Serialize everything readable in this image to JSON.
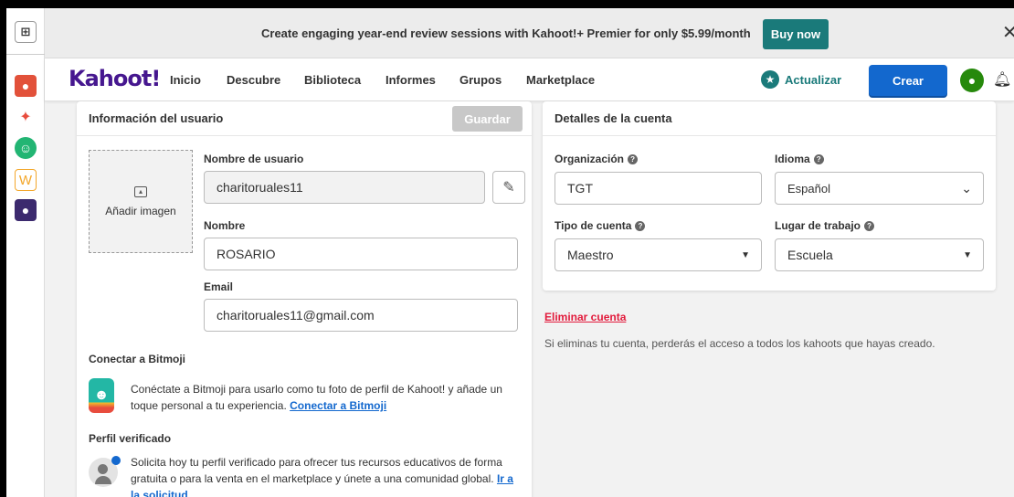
{
  "banner": {
    "text": "Create engaging year-end review sessions with Kahoot!+ Premier for only $5.99/month",
    "button": "Buy now",
    "close": "✕"
  },
  "nav": {
    "logo": "Kahoot!",
    "items": [
      "Inicio",
      "Descubre",
      "Biblioteca",
      "Informes",
      "Grupos",
      "Marketplace"
    ],
    "upgrade": "Actualizar",
    "create": "Crear"
  },
  "user_info": {
    "title": "Información del usuario",
    "save": "Guardar",
    "add_image": "Añadir imagen",
    "username_label": "Nombre de usuario",
    "username": "charitoruales11",
    "name_label": "Nombre",
    "name": "ROSARIO",
    "email_label": "Email",
    "email": "charitoruales11@gmail.com",
    "bitmoji_title": "Conectar a Bitmoji",
    "bitmoji_text": "Conéctate a Bitmoji para usarlo como tu foto de perfil de Kahoot! y añade un toque personal a tu experiencia.",
    "bitmoji_link": "Conectar a Bitmoji",
    "verified_title": "Perfil verificado",
    "verified_text": "Solicita hoy tu perfil verificado para ofrecer tus recursos educativos de forma gratuita o para la venta en el marketplace y únete a una comunidad global.",
    "verified_link": "Ir a la solicitud"
  },
  "account": {
    "title": "Detalles de la cuenta",
    "org_label": "Organización",
    "org": "TGT",
    "lang_label": "Idioma",
    "lang": "Español",
    "type_label": "Tipo de cuenta",
    "type": "Maestro",
    "workplace_label": "Lugar de trabajo",
    "workplace": "Escuela",
    "delete": "Eliminar cuenta",
    "delete_warning": "Si eliminas tu cuenta, perderás el acceso a todos los kahoots que hayas creado."
  },
  "colors": {
    "brand": "#46178f",
    "primary": "#1368ce",
    "teal": "#1a7a7a",
    "danger": "#e21b3c"
  }
}
